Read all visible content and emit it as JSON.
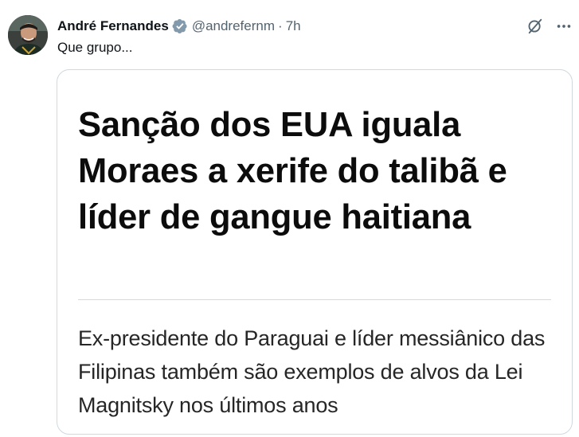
{
  "tweet": {
    "author": {
      "display_name": "André Fernandes",
      "handle": "@andrefernm",
      "verified": true,
      "avatar_icon": "user-avatar"
    },
    "separator": "·",
    "time": "7h",
    "text": "Que grupo...",
    "actions": {
      "grok_icon": "grok-icon",
      "more_icon": "more-dots-icon"
    },
    "media_card": {
      "headline": "Sanção dos EUA iguala Moraes a xerife do talibã e líder de gangue haitiana",
      "subheadline": "Ex-presidente do Paraguai e líder messiânico das Filipinas também são exemplos de alvos da Lei Magnitsky nos últimos anos"
    }
  },
  "colors": {
    "text_primary": "#0f1419",
    "text_secondary": "#536471",
    "verified_blue": "#1d9bf0",
    "card_border": "#cfd9de"
  }
}
